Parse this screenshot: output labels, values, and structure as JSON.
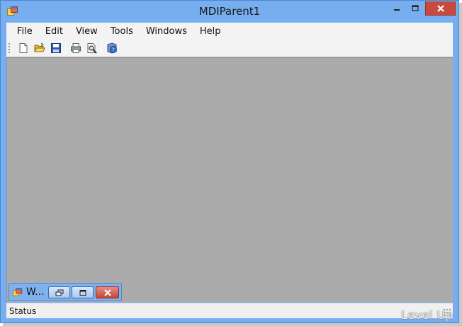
{
  "window": {
    "title": "MDIParent1"
  },
  "menu": {
    "items": [
      {
        "label": "File"
      },
      {
        "label": "Edit"
      },
      {
        "label": "View"
      },
      {
        "label": "Tools"
      },
      {
        "label": "Windows"
      },
      {
        "label": "Help"
      }
    ]
  },
  "toolbar": {
    "buttons": [
      "new-icon",
      "open-icon",
      "save-icon",
      "print-icon",
      "print-preview-icon",
      "help-icon"
    ]
  },
  "child_window": {
    "title": "W..."
  },
  "status": {
    "text": "Status"
  },
  "watermark": {
    "text": "Level Up"
  },
  "colors": {
    "titlebar": "#77aef0",
    "client_area": "#ababab",
    "close_button": "#c74a3d",
    "menubar": "#f3f3f3"
  }
}
